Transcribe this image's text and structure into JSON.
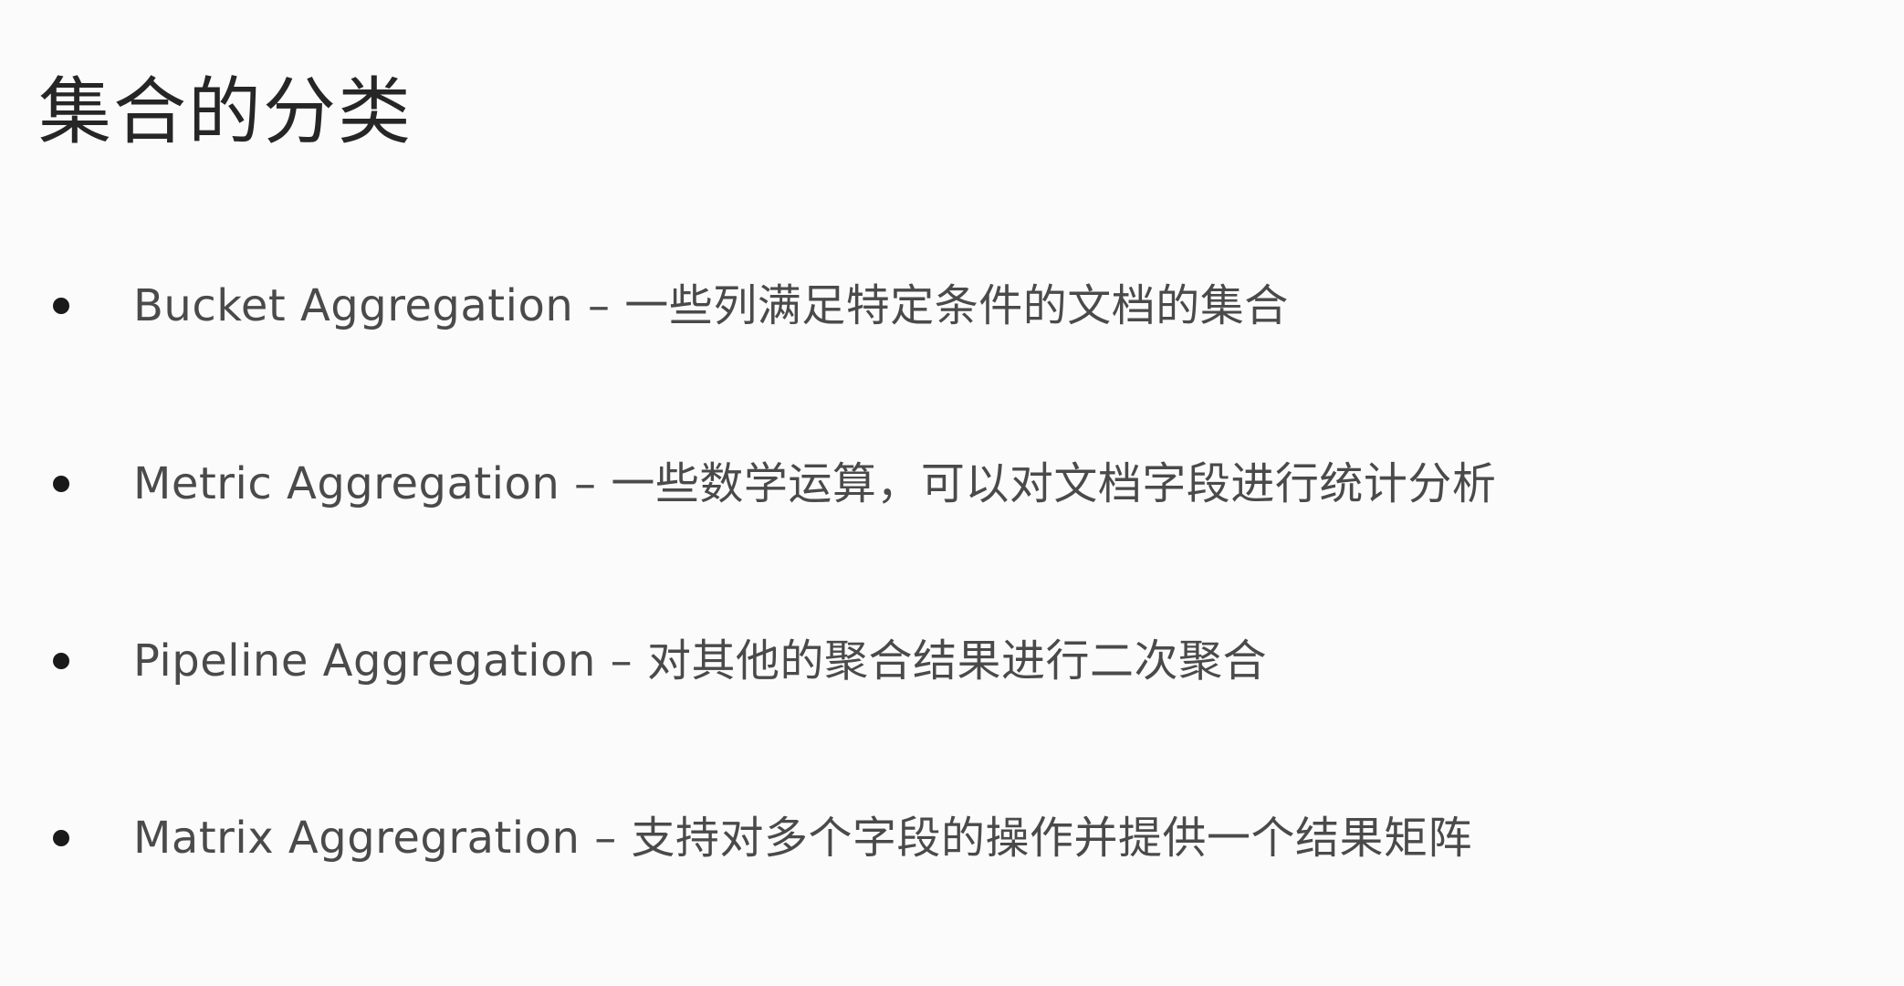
{
  "slide": {
    "title": "集合的分类",
    "bullets": [
      {
        "text": "Bucket Aggregation – 一些列满足特定条件的文档的集合"
      },
      {
        "text": "Metric Aggregation – 一些数学运算，可以对文档字段进行统计分析"
      },
      {
        "text": "Pipeline Aggregation – 对其他的聚合结果进行二次聚合"
      },
      {
        "text": "Matrix Aggregration – 支持对多个字段的操作并提供一个结果矩阵"
      }
    ]
  }
}
